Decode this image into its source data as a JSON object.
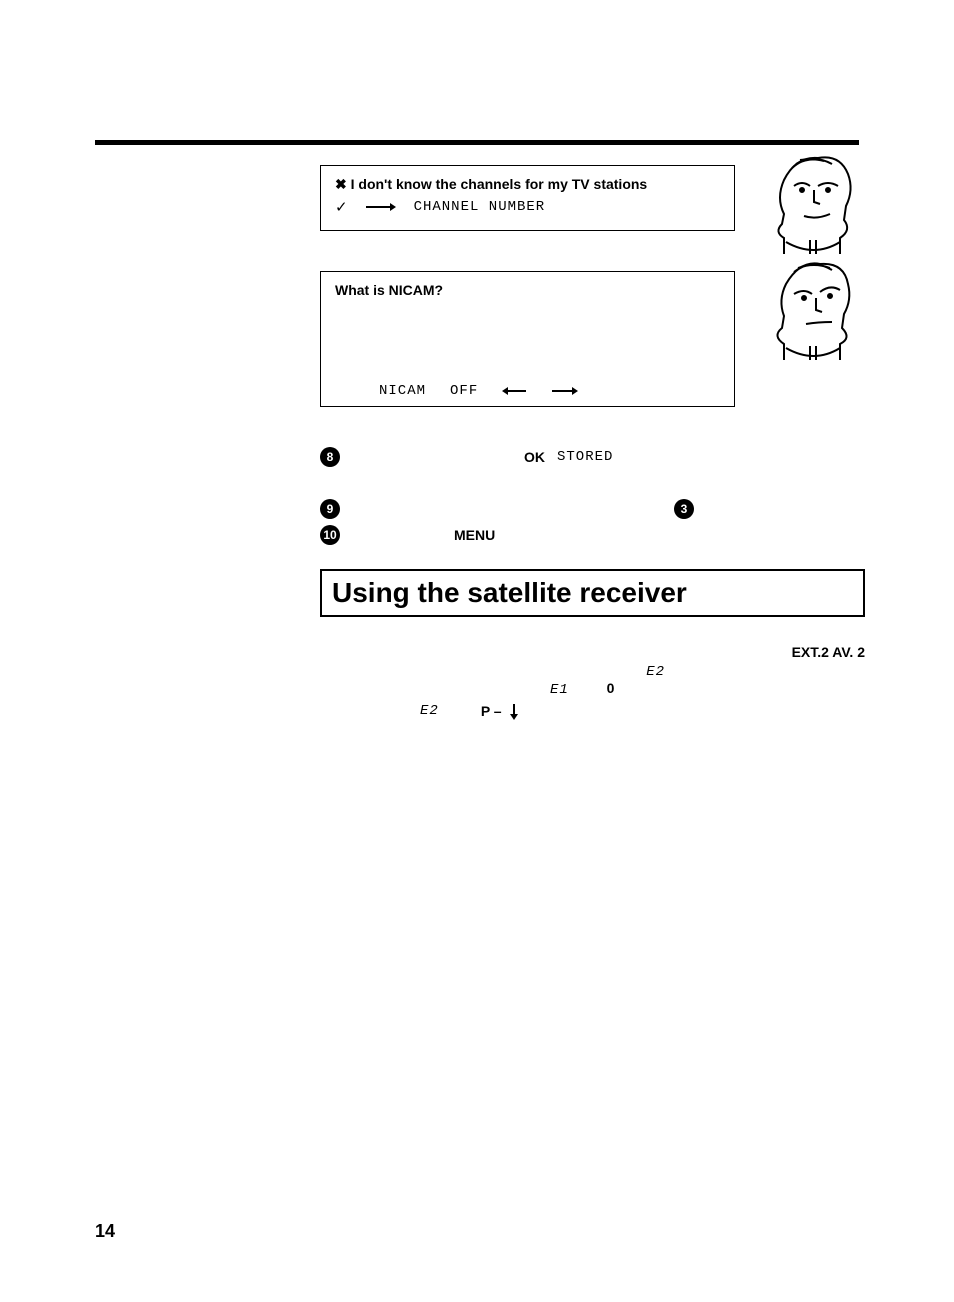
{
  "page_number": "14",
  "box1": {
    "title": "I don't know the channels for my TV stations",
    "label": "CHANNEL NUMBER"
  },
  "box2": {
    "title": "What is NICAM?",
    "nicam_text": "NICAM",
    "off_text": "OFF"
  },
  "step8": {
    "num": "8",
    "ok": "OK",
    "stored": "STORED"
  },
  "step9": {
    "num": "9",
    "ref": "3"
  },
  "step10": {
    "num": "10",
    "menu": "MENU"
  },
  "section_title": "Using the satellite receiver",
  "sat": {
    "ext_label": "EXT.2  AV. 2",
    "e2": "E2",
    "e1": "E1",
    "zero": "0",
    "p_minus": "P –",
    "e2b": "E2"
  }
}
